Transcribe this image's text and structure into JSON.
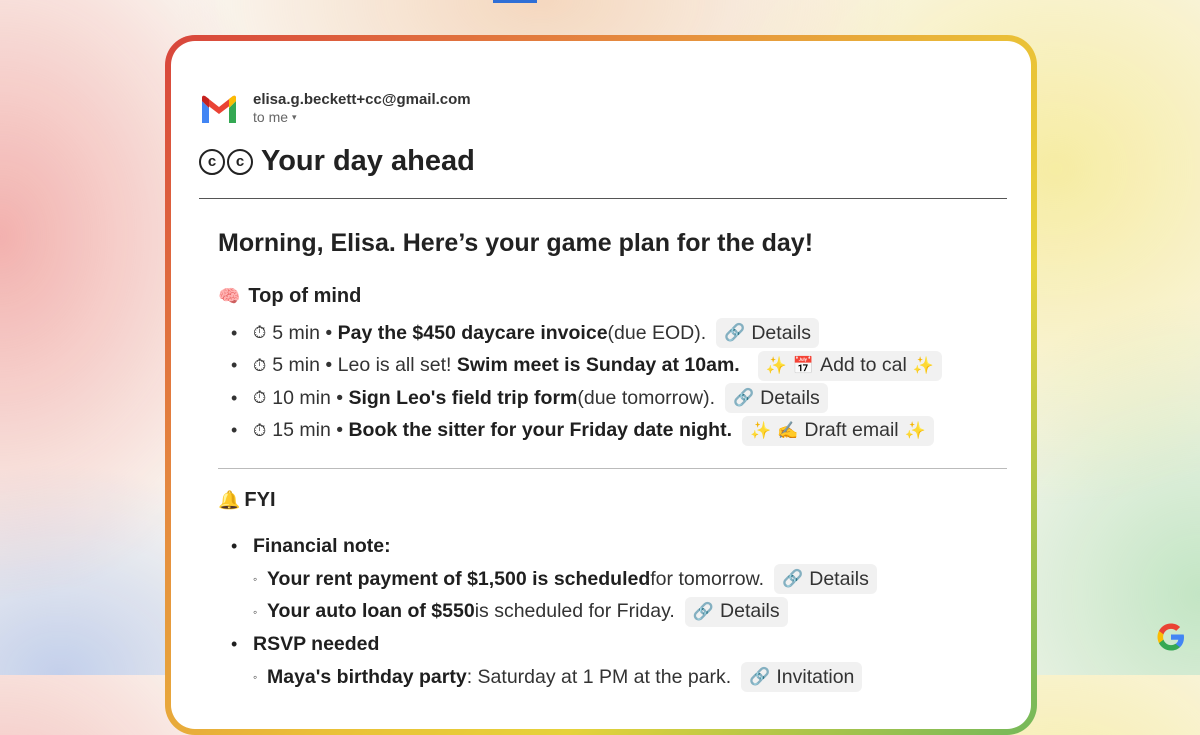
{
  "email": {
    "sender": "elisa.g.beckett+cc@gmail.com",
    "recipient": "to me",
    "title": "Your day ahead",
    "greeting": "Morning, Elisa. Here’s your game plan for the day!"
  },
  "top_of_mind": {
    "heading": "Top of mind",
    "items": [
      {
        "time": "5 min",
        "pre": "",
        "bold": "Pay the $450 daycare invoice",
        "post": " (due EOD).",
        "action": "Details"
      },
      {
        "time": "5 min",
        "pre": "Leo is all set! ",
        "bold": "Swim meet is Sunday at 10am.",
        "post": "",
        "action": "Add to cal"
      },
      {
        "time": "10 min",
        "pre": "",
        "bold": "Sign Leo's field trip form",
        "post": " (due tomorrow).",
        "action": "Details"
      },
      {
        "time": "15 min",
        "pre": "",
        "bold": "Book the sitter for your Friday date night.",
        "post": "",
        "action": "Draft email"
      }
    ]
  },
  "fyi": {
    "heading": "FYI",
    "financial": {
      "label": "Financial note:",
      "items": [
        {
          "bold": "Your rent payment of $1,500 is scheduled",
          "post": " for tomorrow.",
          "action": "Details"
        },
        {
          "bold": "Your auto loan of $550",
          "post": " is scheduled for Friday.",
          "action": "Details"
        }
      ]
    },
    "rsvp": {
      "label": "RSVP needed",
      "items": [
        {
          "bold": "Maya's birthday party",
          "post": ": Saturday at 1 PM at the park.",
          "action": "Invitation"
        }
      ]
    }
  },
  "icons": {
    "timer": "stopwatch-icon",
    "link": "link-icon",
    "sparkle": "sparkle-icon",
    "brain": "brain-icon",
    "bell": "bell-icon"
  }
}
